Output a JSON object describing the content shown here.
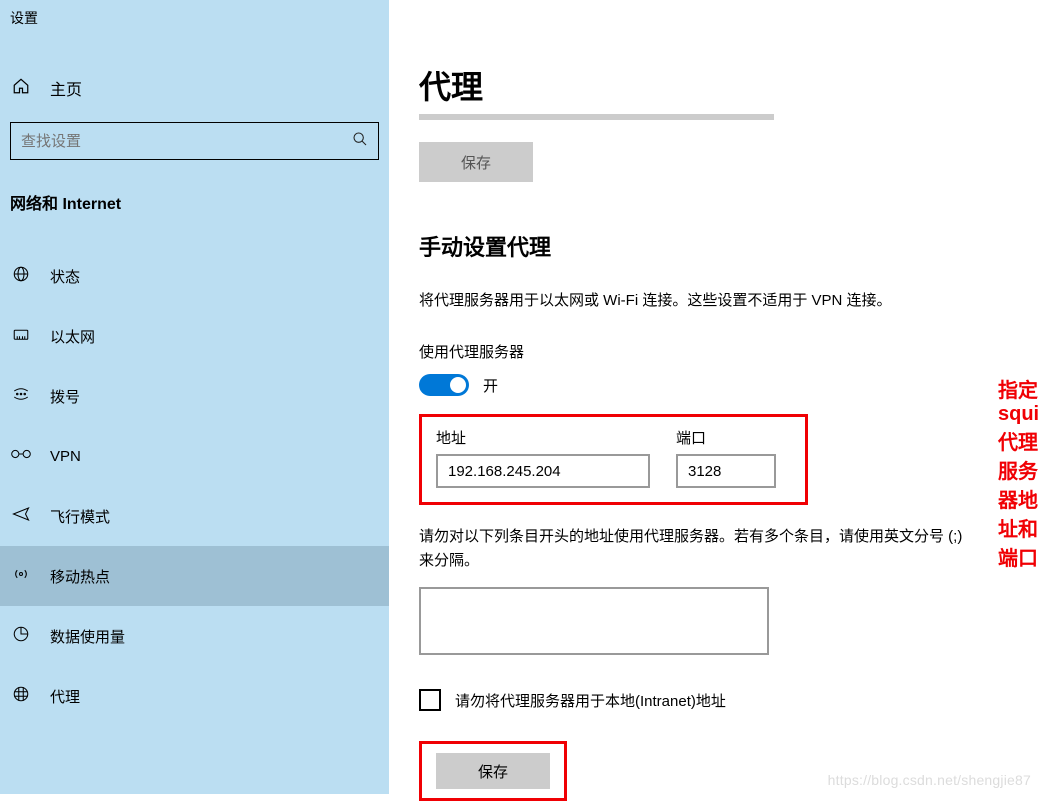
{
  "app_title": "设置",
  "home": "主页",
  "search_placeholder": "查找设置",
  "section_header": "网络和 Internet",
  "nav": [
    {
      "label": "状态",
      "icon": "globe-icon"
    },
    {
      "label": "以太网",
      "icon": "ethernet-icon"
    },
    {
      "label": "拨号",
      "icon": "dialup-icon"
    },
    {
      "label": "VPN",
      "icon": "vpn-icon"
    },
    {
      "label": "飞行模式",
      "icon": "airplane-icon"
    },
    {
      "label": "移动热点",
      "icon": "hotspot-icon"
    },
    {
      "label": "数据使用量",
      "icon": "data-icon"
    },
    {
      "label": "代理",
      "icon": "proxy-icon"
    }
  ],
  "active_nav_index": 5,
  "page": {
    "title": "代理",
    "save": "保存",
    "manual_header": "手动设置代理",
    "manual_desc": "将代理服务器用于以太网或 Wi-Fi 连接。这些设置不适用于 VPN 连接。",
    "use_proxy_label": "使用代理服务器",
    "toggle_state": "开",
    "address_label": "地址",
    "address_value": "192.168.245.204",
    "port_label": "端口",
    "port_value": "3128",
    "bypass_desc": "请勿对以下列条目开头的地址使用代理服务器。若有多个条目，请使用英文分号 (;) 来分隔。",
    "bypass_value": "",
    "checkbox_label": "请勿将代理服务器用于本地(Intranet)地址",
    "save_bottom": "保存"
  },
  "annotation": "指定squid代理服务器地址和端口",
  "watermark": "https://blog.csdn.net/shengjie87"
}
